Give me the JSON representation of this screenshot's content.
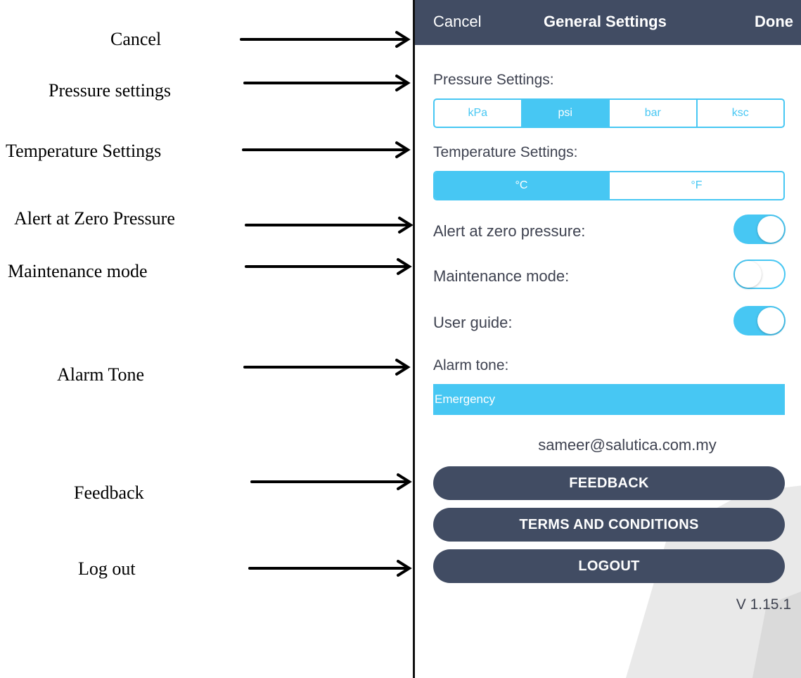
{
  "annotations": [
    {
      "label": "Cancel"
    },
    {
      "label": "Pressure settings"
    },
    {
      "label": "Temperature Settings"
    },
    {
      "label": "Alert at Zero Pressure"
    },
    {
      "label": "Maintenance mode"
    },
    {
      "label": "Alarm Tone"
    },
    {
      "label": "Feedback"
    },
    {
      "label": "Log out"
    }
  ],
  "navbar": {
    "cancel_label": "Cancel",
    "title": "General Settings",
    "done_label": "Done",
    "background": "#414c63"
  },
  "pressure": {
    "label": "Pressure Settings:",
    "options": [
      "kPa",
      "psi",
      "bar",
      "ksc"
    ],
    "selected": "psi"
  },
  "temperature": {
    "label": "Temperature Settings:",
    "options": [
      "°C",
      "°F"
    ],
    "selected": "°C"
  },
  "toggles": {
    "alert_zero": {
      "label": "Alert at zero pressure:",
      "on": true
    },
    "maintenance": {
      "label": "Maintenance mode:",
      "on": false
    },
    "user_guide": {
      "label": "User guide:",
      "on": true
    }
  },
  "alarm": {
    "label": "Alarm tone:",
    "value": "Emergency"
  },
  "account": {
    "email": "sameer@salutica.com.my"
  },
  "buttons": {
    "feedback": "FEEDBACK",
    "terms": "TERMS AND CONDITIONS",
    "logout": "LOGOUT"
  },
  "version": "V 1.15.1",
  "colors": {
    "accent": "#47c7f3",
    "dark": "#414c63",
    "text": "#3e4250"
  }
}
